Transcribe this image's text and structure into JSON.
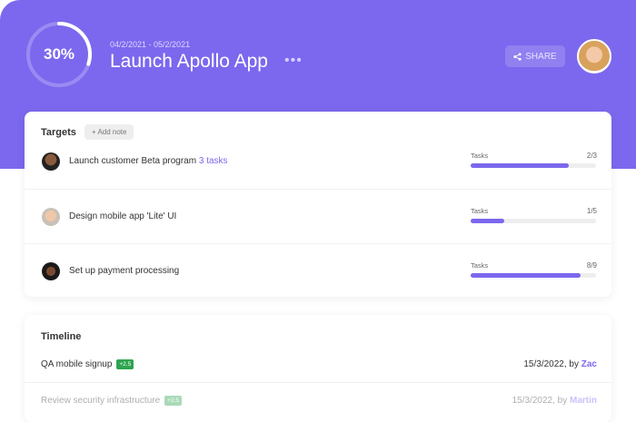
{
  "header": {
    "progress_label": "30%",
    "progress": 0.3,
    "dates": "04/2/2021 - 05/2/2021",
    "title": "Launch Apollo App",
    "more": "•••",
    "share": "SHARE"
  },
  "targets": {
    "title": "Targets",
    "add_note": "+ Add note",
    "items": [
      {
        "name": "Launch customer Beta program",
        "link": "3 tasks",
        "label": "Tasks",
        "count": "2/3",
        "fraction": 0.78
      },
      {
        "name": "Design mobile app 'Lite' UI",
        "link": "",
        "label": "Tasks",
        "count": "1/5",
        "fraction": 0.27
      },
      {
        "name": "Set up payment processing",
        "link": "",
        "label": "Tasks",
        "count": "8/9",
        "fraction": 0.88
      }
    ]
  },
  "timeline": {
    "title": "Timeline",
    "items": [
      {
        "name": "QA mobile signup",
        "badge": "+2.5",
        "date": "15/3/2022, by",
        "user": "Zac"
      },
      {
        "name": "Review security infrastructure",
        "badge": "+2.5",
        "date": "15/3/2022, by",
        "user": "Martin"
      }
    ]
  }
}
